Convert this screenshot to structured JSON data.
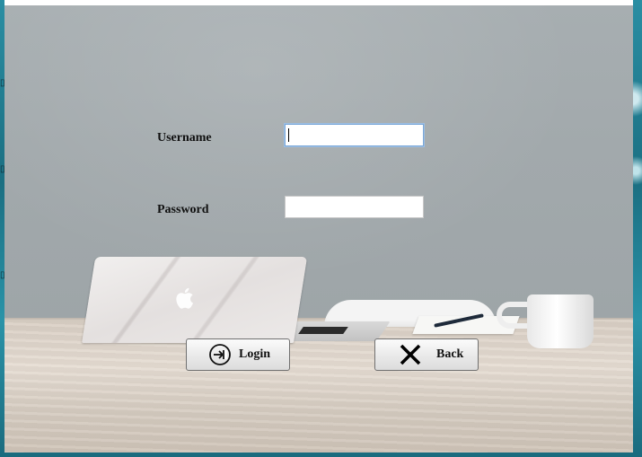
{
  "form": {
    "username_label": "Username",
    "password_label": "Password",
    "username_value": "",
    "password_value": ""
  },
  "buttons": {
    "login_label": "Login",
    "login_icon": "sign-in-icon",
    "back_label": "Back",
    "back_icon": "close-x-icon"
  },
  "colors": {
    "window_bg": "#a9b0b3",
    "desktop_bg": "#1f7f94",
    "focus_border": "#7aa7d8"
  }
}
